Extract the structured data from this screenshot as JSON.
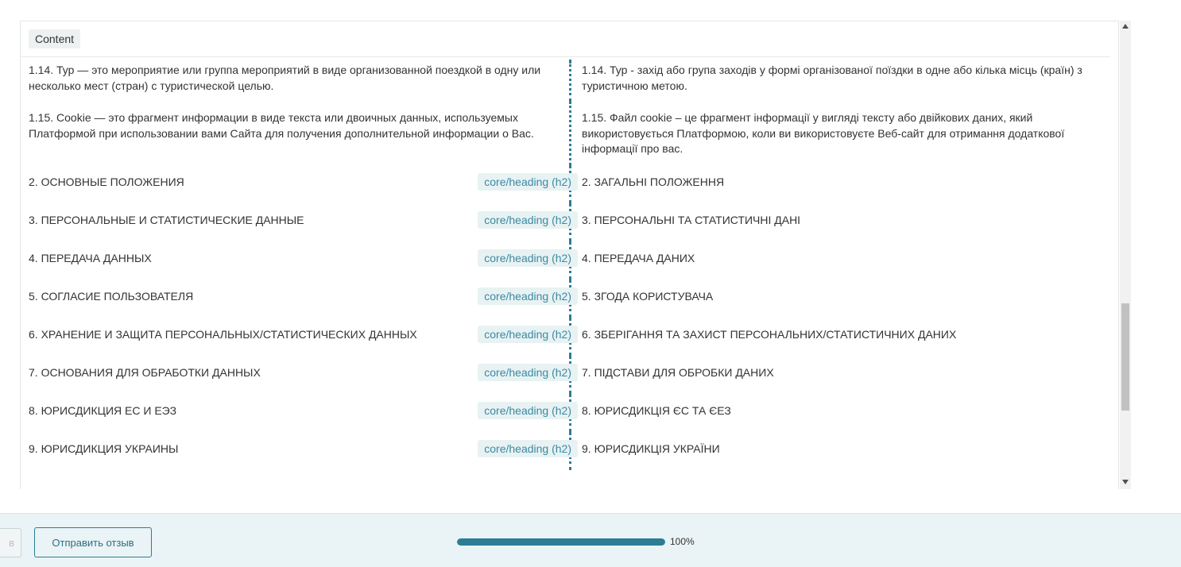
{
  "panel": {
    "tab_label": "Content"
  },
  "paragraphs": [
    {
      "left": "1.14. Тур — это мероприятие или группа мероприятий в виде организованной поездкой в одну или несколько мест (стран) с туристической целью.",
      "right": "1.14. Тур - захід або група заходів у формі організованої поїздки в одне або кілька місць (країн) з туристичною метою."
    },
    {
      "left": "1.15. Cookie — это фрагмент информации в виде текста или двоичных данных, используемых Платформой при использовании вами Сайта для получения дополнительной информации о Вас.",
      "right": "1.15. Файл cookie – це фрагмент інформації у вигляді тексту або двійкових даних, який використовується Платформою, коли ви використовуєте Веб-сайт для отримання додаткової інформації про вас."
    }
  ],
  "headings": [
    {
      "left": "2. ОСНОВНЫЕ ПОЛОЖЕНИЯ",
      "badge": "core/heading (h2)",
      "right": "2. ЗАГАЛЬНІ ПОЛОЖЕННЯ"
    },
    {
      "left": "3. ПЕРСОНАЛЬНЫЕ И СТАТИСТИЧЕСКИЕ ДАННЫЕ",
      "badge": "core/heading (h2)",
      "right": "3. ПЕРСОНАЛЬНІ ТА СТАТИСТИЧНІ ДАНІ"
    },
    {
      "left": "4. ПЕРЕДАЧА ДАННЫХ",
      "badge": "core/heading (h2)",
      "right": "4. ПЕРЕДАЧА ДАНИХ"
    },
    {
      "left": "5. СОГЛАСИЕ ПОЛЬЗОВАТЕЛЯ",
      "badge": "core/heading (h2)",
      "right": "5. ЗГОДА КОРИСТУВАЧА"
    },
    {
      "left": "6. ХРАНЕНИЕ И ЗАЩИТА ПЕРСОНАЛЬНЫХ/СТАТИСТИЧЕСКИХ ДАННЫХ",
      "badge": "core/heading (h2)",
      "right": "6. ЗБЕРІГАННЯ ТА ЗАХИСТ ПЕРСОНАЛЬНИХ/СТАТИСТИЧНИХ ДАНИХ"
    },
    {
      "left": "7. ОСНОВАНИЯ ДЛЯ ОБРАБОТКИ ДАННЫХ",
      "badge": "core/heading (h2)",
      "right": "7. ПІДСТАВИ ДЛЯ ОБРОБКИ ДАНИХ"
    },
    {
      "left": "8. ЮРИСДИКЦИЯ ЕС И ЕЭЗ",
      "badge": "core/heading (h2)",
      "right": "8. ЮРИСДИКЦІЯ ЄС ТА ЄЕЗ"
    },
    {
      "left": "9. ЮРИСДИКЦИЯ УКРАИНЫ",
      "badge": "core/heading (h2)",
      "right": "9. ЮРИСДИКЦІЯ УКРАЇНИ"
    }
  ],
  "footer": {
    "ghost_button_label": "в",
    "send_button_label": "Отправить отзыв",
    "progress_percent": 100,
    "progress_label": "100%"
  },
  "colors": {
    "accent": "#2b7d96",
    "badge_bg": "#e8f2f3",
    "footer_bg": "#eaf3f5"
  }
}
